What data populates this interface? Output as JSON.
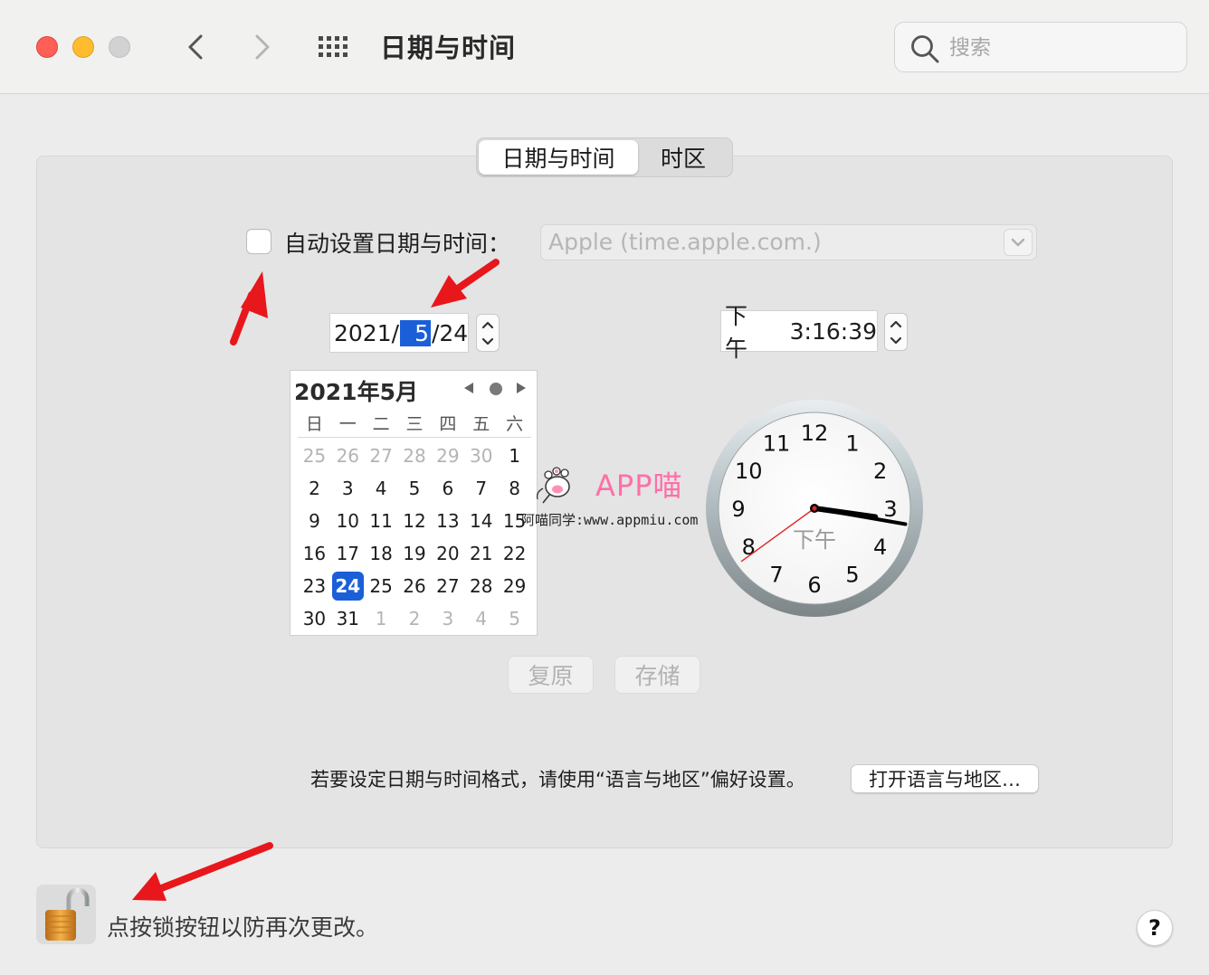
{
  "window": {
    "title": "日期与时间",
    "search_placeholder": "搜索"
  },
  "tabs": [
    {
      "label": "日期与时间",
      "active": true
    },
    {
      "label": "时区",
      "active": false
    }
  ],
  "auto_set": {
    "label": "自动设置日期与时间：",
    "checked": false,
    "server": "Apple (time.apple.com.)"
  },
  "date": {
    "year": "2021",
    "sep1": "/",
    "month": "5",
    "sep2": "/",
    "day": "24"
  },
  "time": {
    "ampm": "下午",
    "value": "3:16:39"
  },
  "calendar": {
    "title": "2021年5月",
    "weekdays": [
      "日",
      "一",
      "二",
      "三",
      "四",
      "五",
      "六"
    ],
    "weeks": [
      [
        {
          "d": "25",
          "m": true
        },
        {
          "d": "26",
          "m": true
        },
        {
          "d": "27",
          "m": true
        },
        {
          "d": "28",
          "m": true
        },
        {
          "d": "29",
          "m": true
        },
        {
          "d": "30",
          "m": true
        },
        {
          "d": "1"
        }
      ],
      [
        {
          "d": "2"
        },
        {
          "d": "3"
        },
        {
          "d": "4"
        },
        {
          "d": "5"
        },
        {
          "d": "6"
        },
        {
          "d": "7"
        },
        {
          "d": "8"
        }
      ],
      [
        {
          "d": "9"
        },
        {
          "d": "10"
        },
        {
          "d": "11"
        },
        {
          "d": "12"
        },
        {
          "d": "13"
        },
        {
          "d": "14"
        },
        {
          "d": "15"
        }
      ],
      [
        {
          "d": "16"
        },
        {
          "d": "17"
        },
        {
          "d": "18"
        },
        {
          "d": "19"
        },
        {
          "d": "20"
        },
        {
          "d": "21"
        },
        {
          "d": "22"
        }
      ],
      [
        {
          "d": "23"
        },
        {
          "d": "24",
          "sel": true
        },
        {
          "d": "25"
        },
        {
          "d": "26"
        },
        {
          "d": "27"
        },
        {
          "d": "28"
        },
        {
          "d": "29"
        }
      ],
      [
        {
          "d": "30"
        },
        {
          "d": "31"
        },
        {
          "d": "1",
          "m": true
        },
        {
          "d": "2",
          "m": true
        },
        {
          "d": "3",
          "m": true
        },
        {
          "d": "4",
          "m": true
        },
        {
          "d": "5",
          "m": true
        }
      ]
    ]
  },
  "clock": {
    "numbers": [
      "12",
      "1",
      "2",
      "3",
      "4",
      "5",
      "6",
      "7",
      "8",
      "9",
      "10",
      "11"
    ],
    "ampm_label": "下午",
    "hour": 3,
    "minute": 16,
    "second": 39
  },
  "watermark": {
    "brand": "APP喵",
    "sub": "阿喵同学:www.appmiu.com"
  },
  "buttons": {
    "revert": "复原",
    "save": "存储",
    "open_region": "打开语言与地区…"
  },
  "hint": "若要设定日期与时间格式，请使用“语言与地区”偏好设置。",
  "lock_text": "点按锁按钮以防再次更改。",
  "help_label": "?",
  "colors": {
    "accent": "#1a5fd8",
    "annotation_arrow": "#e8171c",
    "second_hand": "#e32222"
  }
}
